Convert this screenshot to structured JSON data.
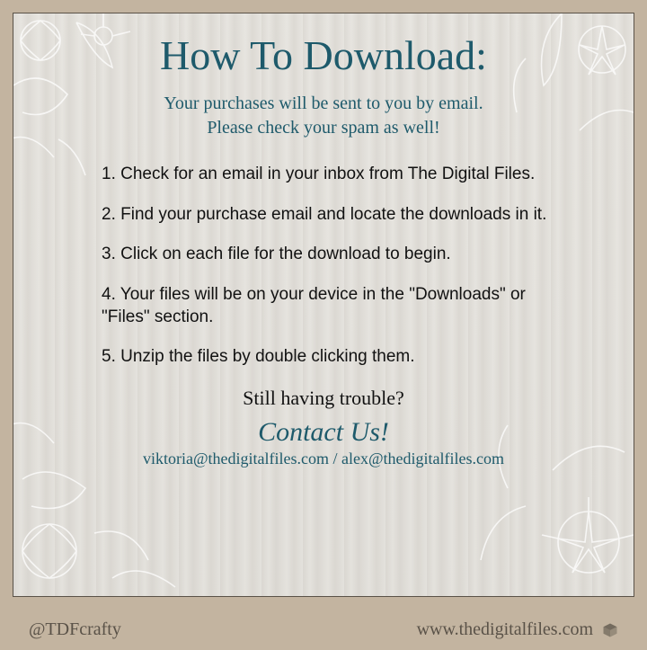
{
  "title": "How To Download:",
  "subtitle_line1": "Your purchases will be sent to you by email.",
  "subtitle_line2": "Please check your spam as well!",
  "steps": {
    "s1": "1. Check for an email in your inbox from The Digital Files.",
    "s2": "2. Find your purchase email and locate the downloads in it.",
    "s3": "3. Click on each file for the download to begin.",
    "s4": "4. Your files will be on your device in the \"Downloads\" or \"Files\" section.",
    "s5": "5. Unzip the files by double clicking them."
  },
  "trouble": "Still having trouble?",
  "contact_header": "Contact Us!",
  "emails": "viktoria@thedigitalfiles.com / alex@thedigitalfiles.com",
  "footer": {
    "handle": "@TDFcrafty",
    "url": "www.thedigitalfiles.com"
  }
}
